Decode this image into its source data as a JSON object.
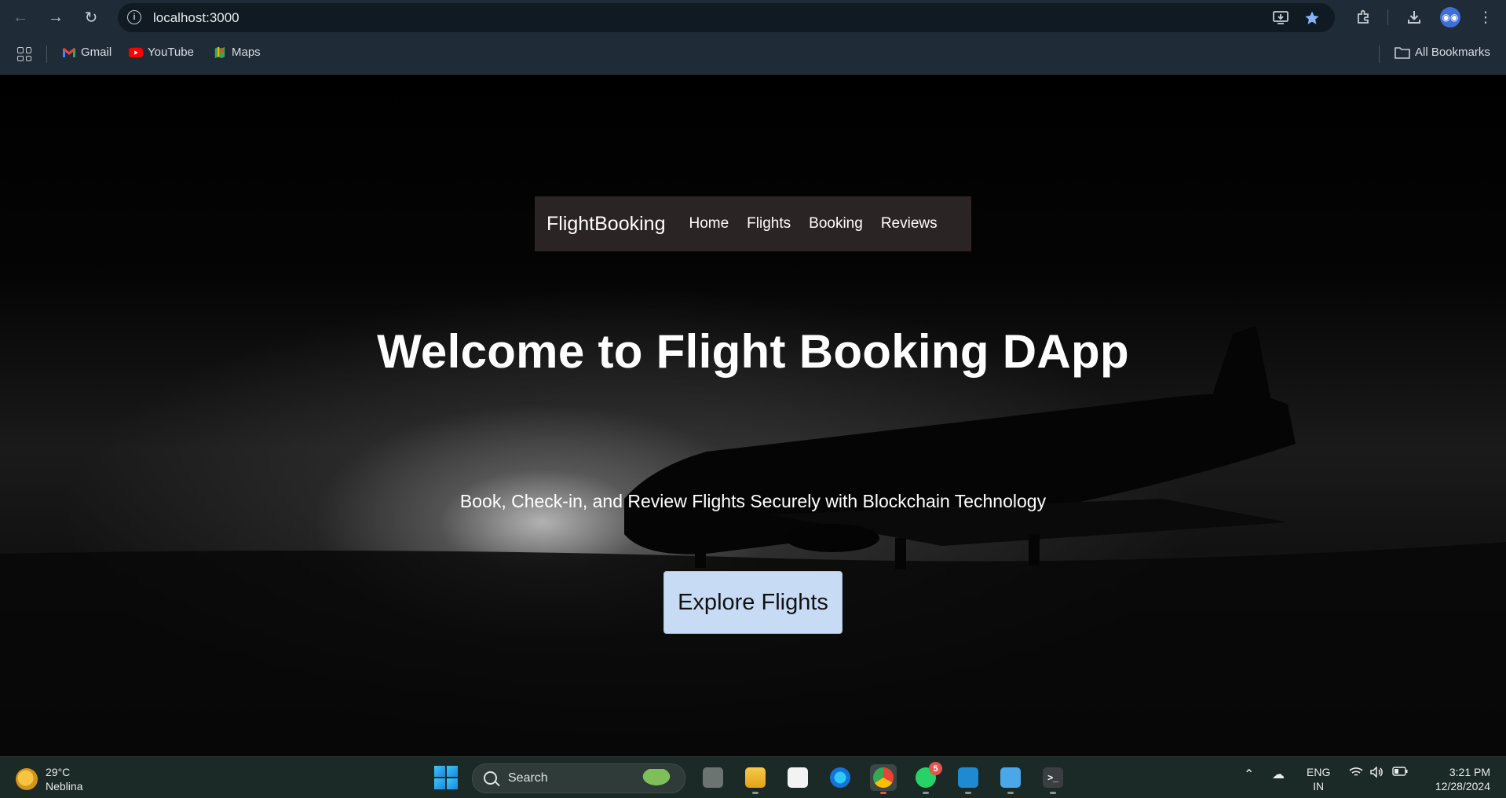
{
  "browser": {
    "url": "localhost:3000",
    "bookmarks": [
      {
        "label": "Gmail",
        "color": "#ea4335"
      },
      {
        "label": "YouTube",
        "color": "#ff0000"
      },
      {
        "label": "Maps",
        "color": "#34a853"
      }
    ],
    "all_bookmarks_label": "All Bookmarks"
  },
  "app": {
    "brand": "FlightBooking",
    "nav": [
      "Home",
      "Flights",
      "Booking",
      "Reviews"
    ],
    "hero_title": "Welcome to Flight Booking DApp",
    "hero_subtitle": "Book, Check-in, and Review Flights Securely with Blockchain Technology",
    "cta_label": "Explore Flights",
    "cta_color": "#c7dbf5",
    "navbar_color": "#2b2424"
  },
  "taskbar": {
    "weather_temp": "29°C",
    "weather_desc": "Neblina",
    "search_label": "Search",
    "whatsapp_badge": "5",
    "lang_line1": "ENG",
    "lang_line2": "IN",
    "time": "3:21 PM",
    "date": "12/28/2024"
  }
}
